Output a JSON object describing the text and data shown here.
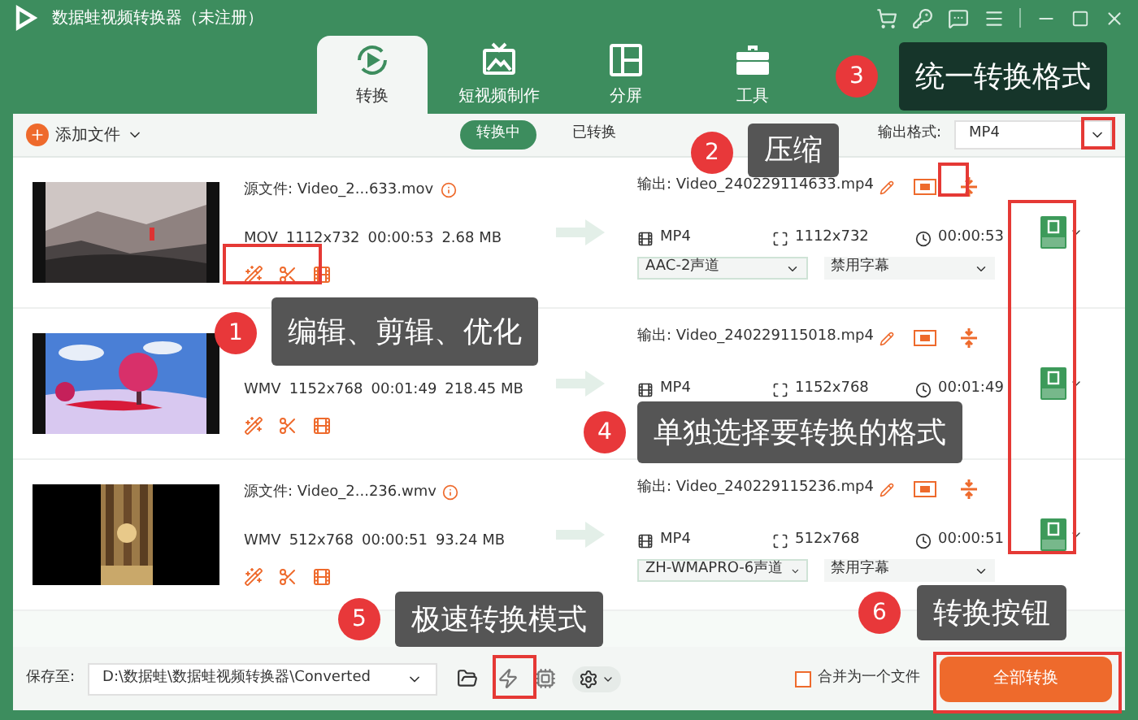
{
  "app_title": "数据蛙视频转换器（未注册）",
  "tabs": [
    {
      "label": "转换",
      "selected": true,
      "kind": "convert"
    },
    {
      "label": "短视频制作",
      "selected": false,
      "kind": "tv"
    },
    {
      "label": "分屏",
      "selected": false,
      "kind": "split"
    },
    {
      "label": "工具",
      "selected": false,
      "kind": "toolbox"
    }
  ],
  "toolbar": {
    "add_file": "添加文件",
    "filters": [
      {
        "label": "转换中",
        "selected": true
      },
      {
        "label": "已转换",
        "selected": false
      }
    ],
    "output_format_label": "输出格式:",
    "output_format": "MP4"
  },
  "files": [
    {
      "source_label": "源文件:",
      "source_name": "Video_2...633.mov",
      "format": "MOV",
      "resolution": "1112x732",
      "duration": "00:00:53",
      "size": "2.68 MB",
      "output_label": "输出:",
      "output_name": "Video_240229114633.mp4",
      "out_format": "MP4",
      "out_resolution": "1112x732",
      "out_duration": "00:00:53",
      "audio": "AAC-2声道",
      "subtitle": "禁用字幕"
    },
    {
      "format": "WMV",
      "resolution": "1152x768",
      "duration": "00:01:49",
      "size": "218.45 MB",
      "output_label": "输出:",
      "output_name": "Video_240229115018.mp4",
      "out_format": "MP4",
      "out_resolution": "1152x768",
      "out_duration": "00:01:49"
    },
    {
      "source_label": "源文件:",
      "source_name": "Video_2...236.wmv",
      "format": "WMV",
      "resolution": "512x768",
      "duration": "00:00:51",
      "size": "93.24 MB",
      "output_label": "输出:",
      "output_name": "Video_240229115236.mp4",
      "out_format": "MP4",
      "out_resolution": "512x768",
      "out_duration": "00:00:51",
      "audio": "ZH-WMAPRO-6声道",
      "subtitle": "禁用字幕"
    }
  ],
  "bottom": {
    "save_to_label": "保存至:",
    "path": "D:\\数据蛙\\数据蛙视频转换器\\Converted",
    "merge_label": "合并为一个文件",
    "merge_checked": false,
    "convert_all": "全部转换"
  },
  "callouts": [
    {
      "number": "1",
      "text": "编辑、剪辑、优化"
    },
    {
      "number": "2",
      "text": "压缩"
    },
    {
      "number": "3",
      "text": "统一转换格式"
    },
    {
      "number": "4",
      "text": "单独选择要转换的格式"
    },
    {
      "number": "5",
      "text": "极速转换模式"
    },
    {
      "number": "6",
      "text": "转换按钮"
    }
  ]
}
